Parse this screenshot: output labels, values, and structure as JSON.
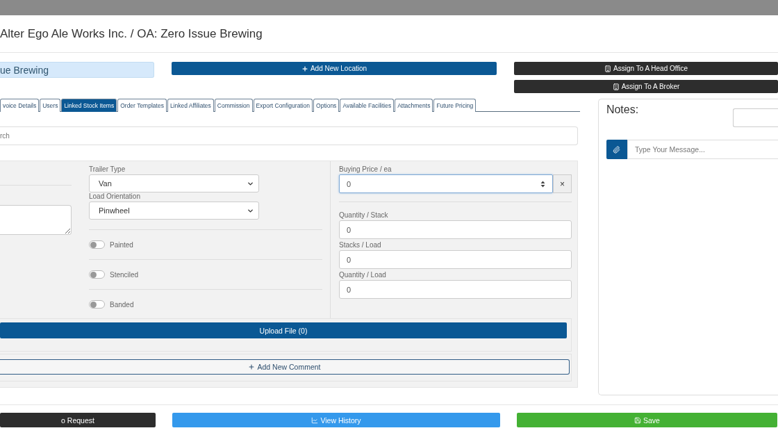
{
  "window": {
    "title": "Alter Ego Ale Works Inc. / OA: Zero Issue Brewing"
  },
  "customer_field": {
    "value": "ue Brewing"
  },
  "add_location_button": {
    "label": "Add New Location"
  },
  "assign_buttons": [
    {
      "label": "Assign To A Head Office"
    },
    {
      "label": "Assign To A Broker"
    }
  ],
  "tabs": [
    {
      "label": "voice Details",
      "selected": false
    },
    {
      "label": "Users",
      "selected": false
    },
    {
      "label": "Linked Stock Items",
      "selected": true
    },
    {
      "label": "Order Templates",
      "selected": false
    },
    {
      "label": "Linked Affiliates",
      "selected": false
    },
    {
      "label": "Commission",
      "selected": false
    },
    {
      "label": "Export Configuration",
      "selected": false
    },
    {
      "label": "Options",
      "selected": false
    },
    {
      "label": "Available Facilities",
      "selected": false
    },
    {
      "label": "Attachments",
      "selected": false
    },
    {
      "label": "Future Pricing",
      "selected": false
    }
  ],
  "search": {
    "placeholder": "rch"
  },
  "selects": [
    {
      "label": "Trailer Type",
      "value": "Van"
    },
    {
      "label": "Load Orientation",
      "value": "Pinwheel"
    }
  ],
  "toggles": [
    {
      "label": "Painted",
      "on": false
    },
    {
      "label": "Stenciled",
      "on": false
    },
    {
      "label": "Banded",
      "on": false
    }
  ],
  "buying_price": {
    "label": "Buying Price / ea",
    "value": "0",
    "clear": "×"
  },
  "quantity_fields": [
    {
      "label": "Quantity / Stack",
      "value": "0"
    },
    {
      "label": "Stacks / Load",
      "value": "0"
    },
    {
      "label": "Quantity / Load",
      "value": "0"
    }
  ],
  "upload_button": {
    "label": "Upload File (0)"
  },
  "comment_button": {
    "label": "Add New Comment"
  },
  "notes": {
    "title": "Notes:",
    "message_placeholder": "Type Your Message..."
  },
  "footer_buttons": [
    {
      "label": "o Request",
      "kind": "dark"
    },
    {
      "label": "View History",
      "kind": "history"
    },
    {
      "label": "Save",
      "kind": "save"
    }
  ]
}
